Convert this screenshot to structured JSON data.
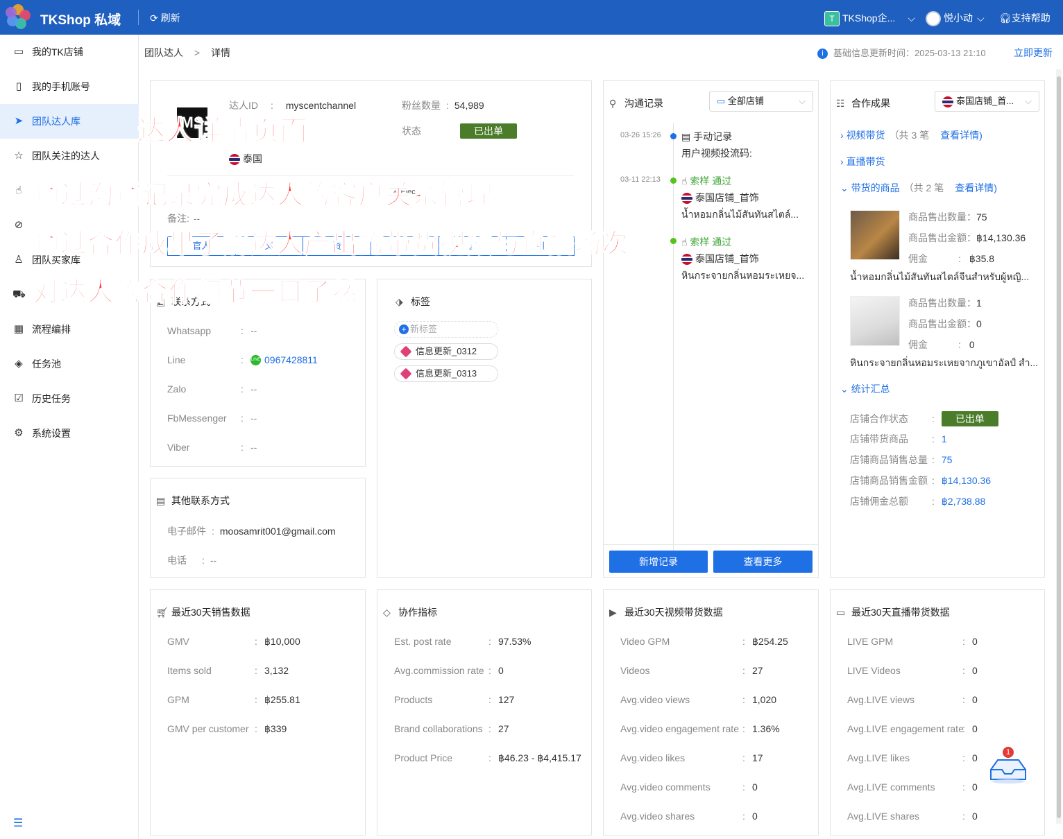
{
  "app": {
    "brand": "TKShop 私域",
    "refresh": "刷新",
    "shop": "TKShop企...",
    "shop_badge": "T",
    "user": "悦小动",
    "help": "支持帮助"
  },
  "sidebar": {
    "items": [
      {
        "label": "我的TK店铺",
        "icon": "store-icon",
        "glyph": "▭"
      },
      {
        "label": "我的手机账号",
        "icon": "phone-icon",
        "glyph": "▯"
      },
      {
        "label": "团队达人库",
        "icon": "send-icon",
        "glyph": "➤",
        "active": true
      },
      {
        "label": "团队关注的达人",
        "icon": "star-icon",
        "glyph": "☆"
      },
      {
        "label": "",
        "icon": "hand-icon",
        "glyph": "☝"
      },
      {
        "label": "",
        "icon": "ban-icon",
        "glyph": "⊘"
      },
      {
        "label": "团队买家库",
        "icon": "user-icon",
        "glyph": "♙"
      },
      {
        "label": "",
        "icon": "truck-icon",
        "glyph": "⛟"
      },
      {
        "label": "流程编排",
        "icon": "calendar-icon",
        "glyph": "▦"
      },
      {
        "label": "任务池",
        "icon": "layers-icon",
        "glyph": "◈"
      },
      {
        "label": "历史任务",
        "icon": "clipboard-icon",
        "glyph": "☑"
      },
      {
        "label": "系统设置",
        "icon": "gear-icon",
        "glyph": "⚙"
      }
    ]
  },
  "breadcrumb": {
    "parent": "团队达人",
    "sep": ">",
    "current": "详情"
  },
  "update": {
    "label": "基础信息更新时间：2025-03-13 21:10",
    "action": "立即更新"
  },
  "profile": {
    "id_label": "达人ID",
    "id_value": "myscentchannel",
    "fans_label": "粉丝数量",
    "fans_value": "54,989",
    "status_label": "状态",
    "status_value": "已出单",
    "region": "泰国",
    "category": "& Elec",
    "remark_label": "备注:",
    "remark_value": "--",
    "tabs": [
      "官人",
      "义",
      "资",
      "",
      "售",
      "用"
    ]
  },
  "contact": {
    "title": "联系方式",
    "rows": [
      {
        "k": "Whatsapp",
        "v": "--"
      },
      {
        "k": "Line",
        "v": "0967428811"
      },
      {
        "k": "Zalo",
        "v": "--"
      },
      {
        "k": "FbMessenger",
        "v": "--"
      },
      {
        "k": "Viber",
        "v": "--"
      }
    ]
  },
  "tags": {
    "title": "标签",
    "new": "新标签",
    "items": [
      "信息更新_0312",
      "信息更新_0313"
    ]
  },
  "other_contact": {
    "title": "其他联系方式",
    "rows": [
      {
        "k": "电子邮件",
        "v": "moosamrit001@gmail.com"
      },
      {
        "k": "电话",
        "v": "--"
      }
    ]
  },
  "comm": {
    "title": "沟通记录",
    "filter": "全部店铺",
    "entries": [
      {
        "time": "03-26 15:26",
        "type": "手动记录",
        "text": "用户视频投流码:"
      },
      {
        "time": "03-11 22:13",
        "type": "索样 通过",
        "shop": "泰国店铺_首饰",
        "text": "น้ำหอมกลิ่นไม้สันทันสไตล์..."
      },
      {
        "time": "",
        "type": "索样 通过",
        "shop": "泰国店铺_首饰",
        "text": "หินกระจายกลิ่นหอมระเหยจ..."
      }
    ],
    "add": "新增记录",
    "more": "查看更多"
  },
  "coop": {
    "title": "合作成果",
    "filter": "泰国店铺_首...",
    "video": "视频带货",
    "video_count": "（共 3 笔",
    "view": "查看详情)",
    "live": "直播带货",
    "goods": "带货的商品",
    "goods_count": "（共 2 笔",
    "products": [
      {
        "sold_label": "商品售出数量：",
        "sold": "75",
        "amount_label": "商品售出金额：",
        "amount": "฿14,130.36",
        "comm_label": "佣金",
        "comm": "฿35.8",
        "name": "น้ำหอมกลิ่นไม้สันทันสไตล์จีนสำหรับผู้หญิ..."
      },
      {
        "sold_label": "商品售出数量：",
        "sold": "1",
        "amount_label": "商品售出金额：",
        "amount": "0",
        "comm_label": "佣金",
        "comm": "0",
        "name": "หินกระจายกลิ่นหอมระเหยจากภูเขาอัลป์ สำ..."
      }
    ],
    "stats": "统计汇总",
    "stat_rows": [
      {
        "k": "店铺合作状态",
        "v": "已出单"
      },
      {
        "k": "店铺带货商品",
        "v": "1"
      },
      {
        "k": "店铺商品销售总量",
        "v": "75"
      },
      {
        "k": "店铺商品销售金额",
        "v": "฿14,130.36"
      },
      {
        "k": "店铺佣金总额",
        "v": "฿2,738.88"
      }
    ]
  },
  "sales": {
    "title": "最近30天销售数据",
    "rows": [
      {
        "k": "GMV",
        "v": "฿10,000"
      },
      {
        "k": "Items sold",
        "v": "3,132"
      },
      {
        "k": "GPM",
        "v": "฿255.81"
      },
      {
        "k": "GMV per customer",
        "v": "฿339"
      }
    ]
  },
  "metrics": {
    "title": "协作指标",
    "rows": [
      {
        "k": "Est. post rate",
        "v": "97.53%"
      },
      {
        "k": "Avg.commission rate",
        "v": "0"
      },
      {
        "k": "Products",
        "v": "127"
      },
      {
        "k": "Brand collaborations",
        "v": "27"
      },
      {
        "k": "Product Price",
        "v": "฿46.23  -  ฿4,415.17"
      }
    ]
  },
  "video": {
    "title": "最近30天视频带货数据",
    "rows": [
      {
        "k": "Video GPM",
        "v": "฿254.25"
      },
      {
        "k": "Videos",
        "v": "27"
      },
      {
        "k": "Avg.video views",
        "v": "1,020"
      },
      {
        "k": "Avg.video engagement rate",
        "v": "1.36%"
      },
      {
        "k": "Avg.video likes",
        "v": "17"
      },
      {
        "k": "Avg.video comments",
        "v": "0"
      },
      {
        "k": "Avg.video shares",
        "v": "0"
      }
    ]
  },
  "live": {
    "title": "最近30天直播带货数据",
    "rows": [
      {
        "k": "LIVE GPM",
        "v": "0"
      },
      {
        "k": "LIVE Videos",
        "v": "0"
      },
      {
        "k": "Avg.LIVE views",
        "v": "0"
      },
      {
        "k": "Avg.LIVE engagement rate",
        "v": "0"
      },
      {
        "k": "Avg.LIVE likes",
        "v": "0"
      },
      {
        "k": "Avg.LIVE comments",
        "v": "0"
      },
      {
        "k": "Avg.LIVE shares",
        "v": "0"
      }
    ]
  },
  "overlay": [
    "达人详情页面",
    "通过沟通记录完成达人的客户关系管理",
    "通过合作成果了解达人产出的带货视频与直播场次",
    "对达人的合作细节一目了然"
  ],
  "inbox_badge": "1"
}
